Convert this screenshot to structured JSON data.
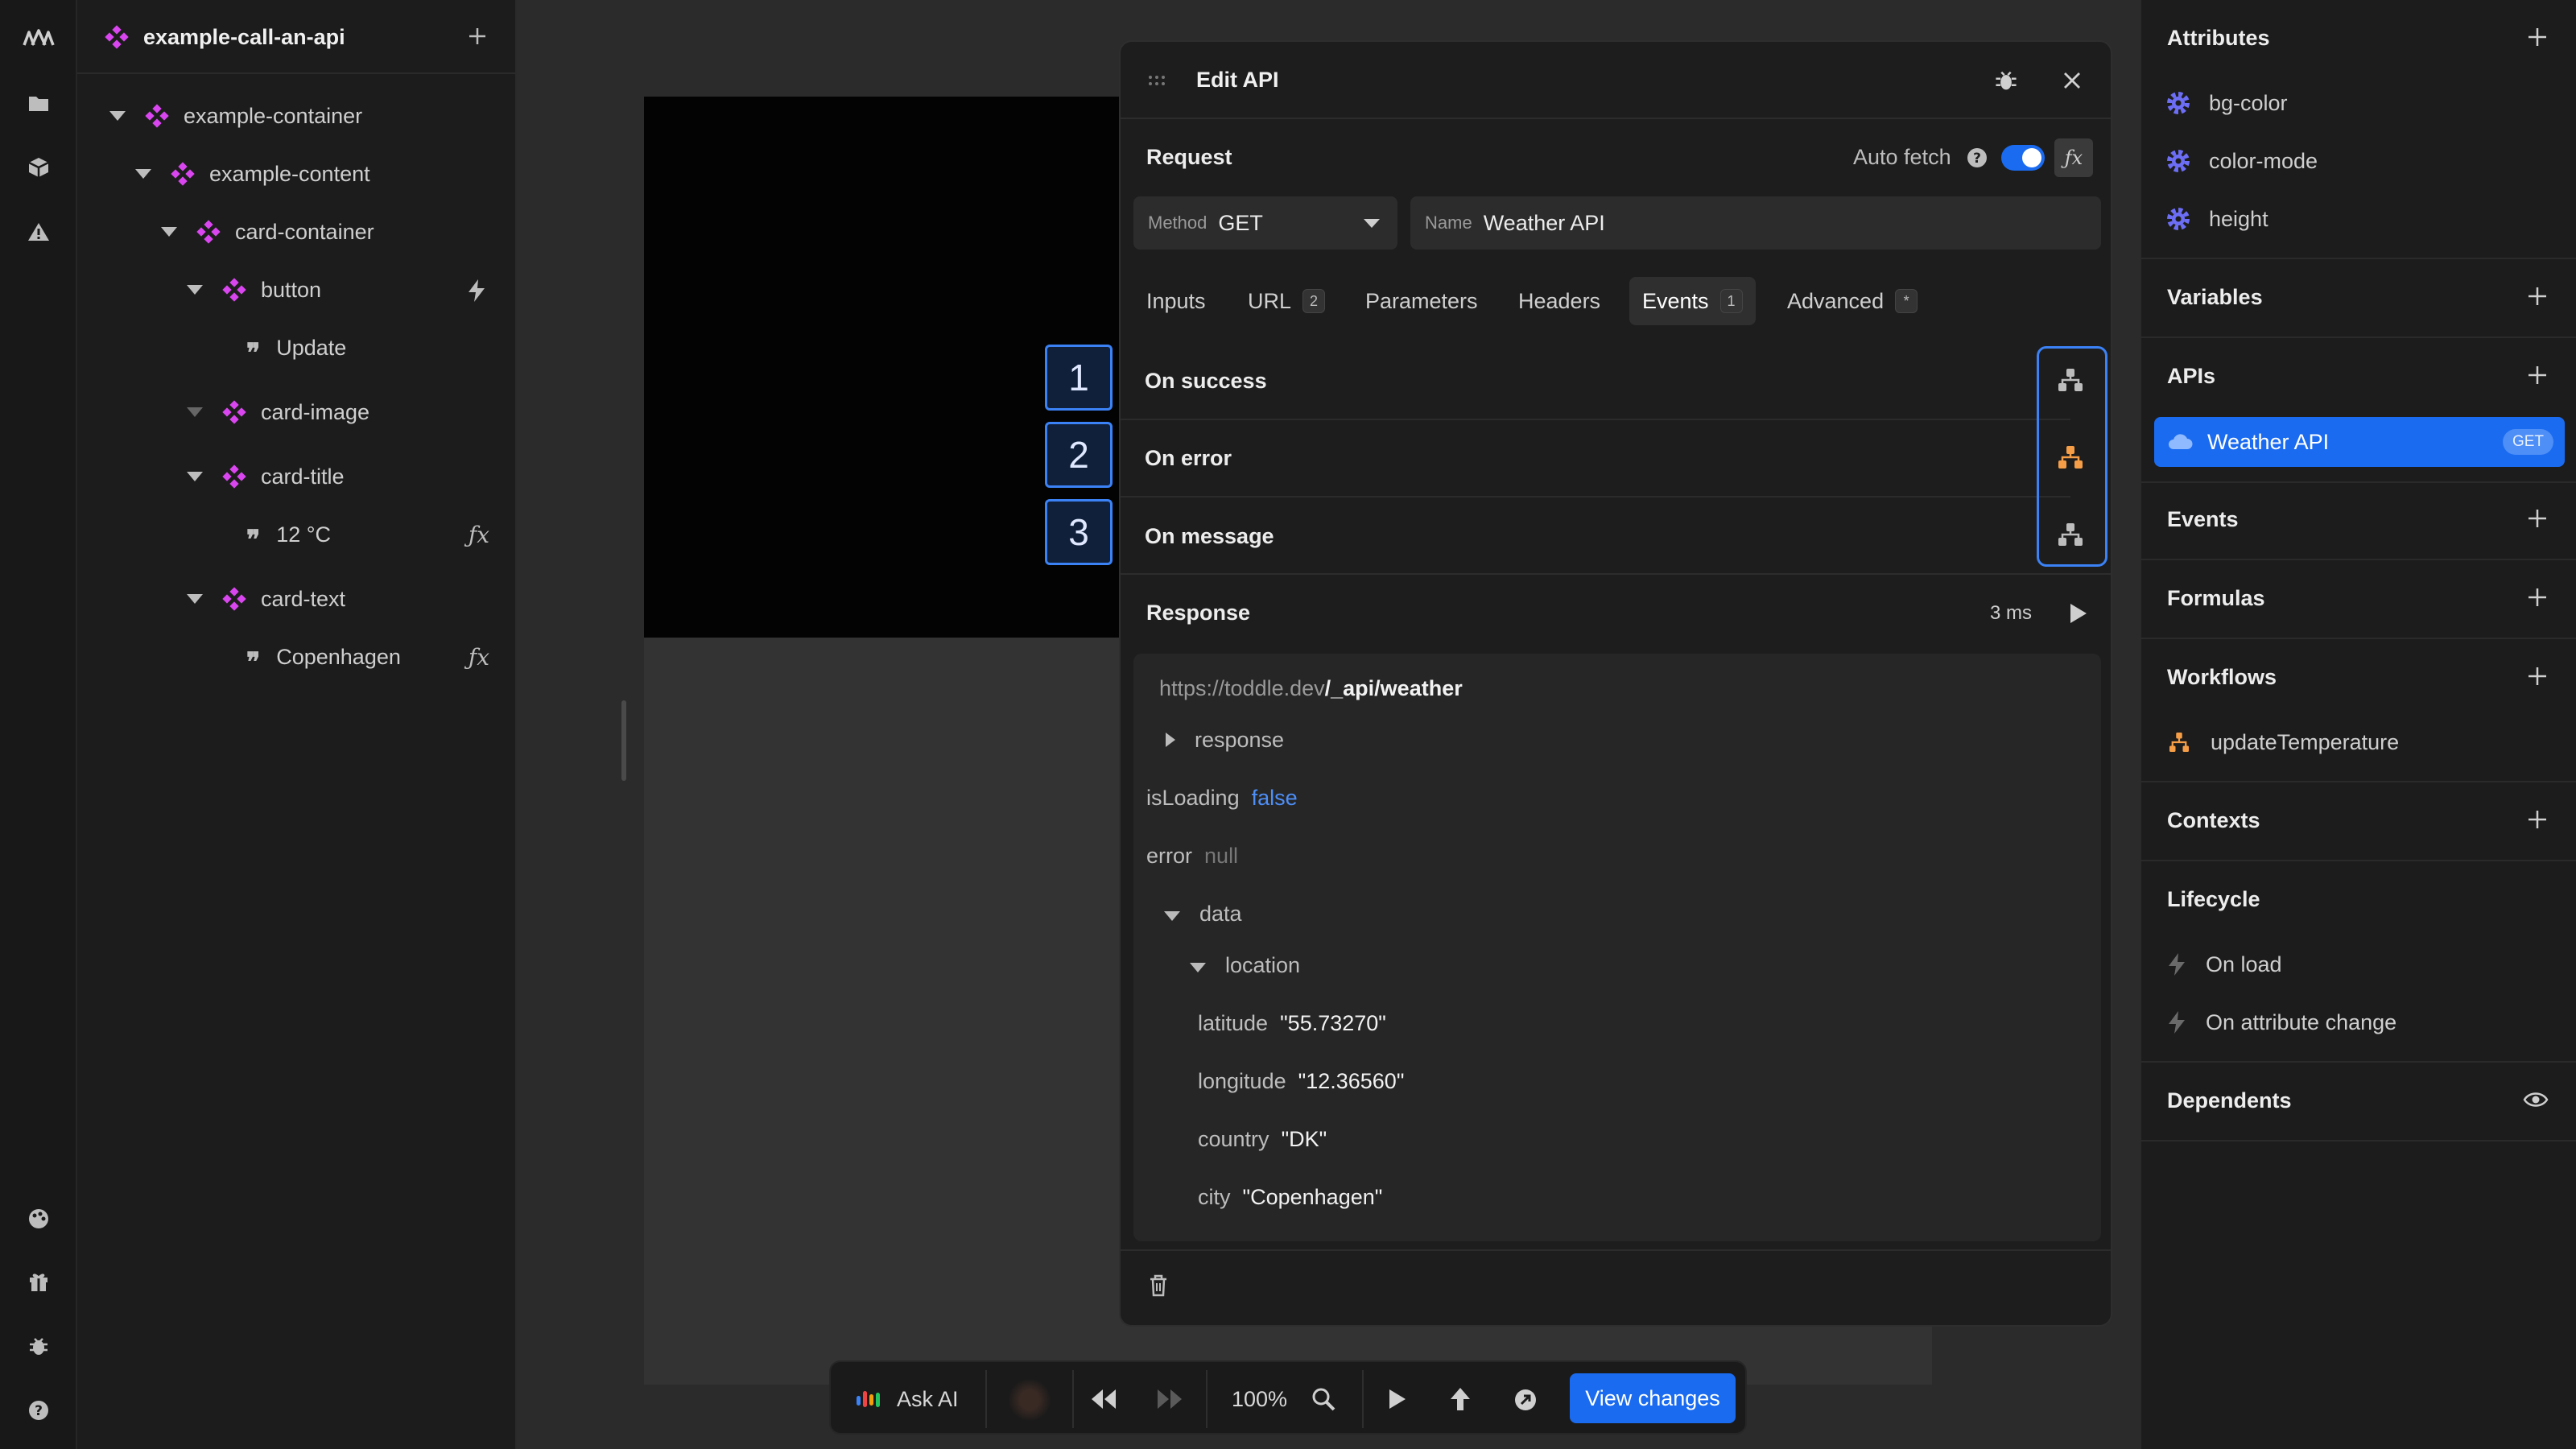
{
  "tree": {
    "title": "example-call-an-api",
    "nodes": [
      {
        "label": "example-container"
      },
      {
        "label": "example-content"
      },
      {
        "label": "card-container"
      },
      {
        "label": "button"
      },
      {
        "label": "Update"
      },
      {
        "label": "card-image"
      },
      {
        "label": "card-title"
      },
      {
        "label": "12 °C"
      },
      {
        "label": "card-text"
      },
      {
        "label": "Copenhagen"
      }
    ]
  },
  "markers": [
    "1",
    "2",
    "3"
  ],
  "dialog": {
    "title": "Edit API",
    "request_label": "Request",
    "auto_fetch_label": "Auto fetch",
    "auto_fetch_on": true,
    "method": {
      "label": "Method",
      "value": "GET"
    },
    "name": {
      "label": "Name",
      "value": "Weather API"
    },
    "tabs": [
      {
        "label": "Inputs"
      },
      {
        "label": "URL",
        "badge": "2"
      },
      {
        "label": "Parameters"
      },
      {
        "label": "Headers"
      },
      {
        "label": "Events",
        "badge": "1",
        "active": true
      },
      {
        "label": "Advanced",
        "badge": "*"
      }
    ],
    "events": [
      {
        "label": "On success",
        "color": "#bdbdbd"
      },
      {
        "label": "On error",
        "color": "#f59e47"
      },
      {
        "label": "On message",
        "color": "#bdbdbd"
      }
    ],
    "response": {
      "label": "Response",
      "time": "3 ms",
      "url_base": "https://toddle.dev",
      "url_path": "/_api/weather",
      "response_key": "response",
      "isLoading_key": "isLoading",
      "isLoading_value": "false",
      "error_key": "error",
      "error_value": "null",
      "data_key": "data",
      "location_key": "location",
      "fields": [
        {
          "key": "latitude",
          "value": "\"55.73270\""
        },
        {
          "key": "longitude",
          "value": "\"12.36560\""
        },
        {
          "key": "country",
          "value": "\"DK\""
        },
        {
          "key": "city",
          "value": "\"Copenhagen\""
        }
      ]
    }
  },
  "toolbar": {
    "ask_ai": "Ask AI",
    "zoom": "100%",
    "view_changes": "View changes"
  },
  "right": {
    "attributes": {
      "title": "Attributes",
      "items": [
        "bg-color",
        "color-mode",
        "height"
      ]
    },
    "variables": {
      "title": "Variables"
    },
    "apis": {
      "title": "APIs",
      "item": "Weather API",
      "badge": "GET"
    },
    "events": {
      "title": "Events"
    },
    "formulas": {
      "title": "Formulas"
    },
    "workflows": {
      "title": "Workflows",
      "items": [
        "updateTemperature"
      ]
    },
    "contexts": {
      "title": "Contexts"
    },
    "lifecycle": {
      "title": "Lifecycle",
      "items": [
        "On load",
        "On attribute change"
      ]
    },
    "dependents": {
      "title": "Dependents"
    }
  },
  "colors": {
    "accent": "#1a6bf0",
    "component": "#d946ef",
    "attribute": "#6d6ef6",
    "workflow": "#f59e47"
  }
}
